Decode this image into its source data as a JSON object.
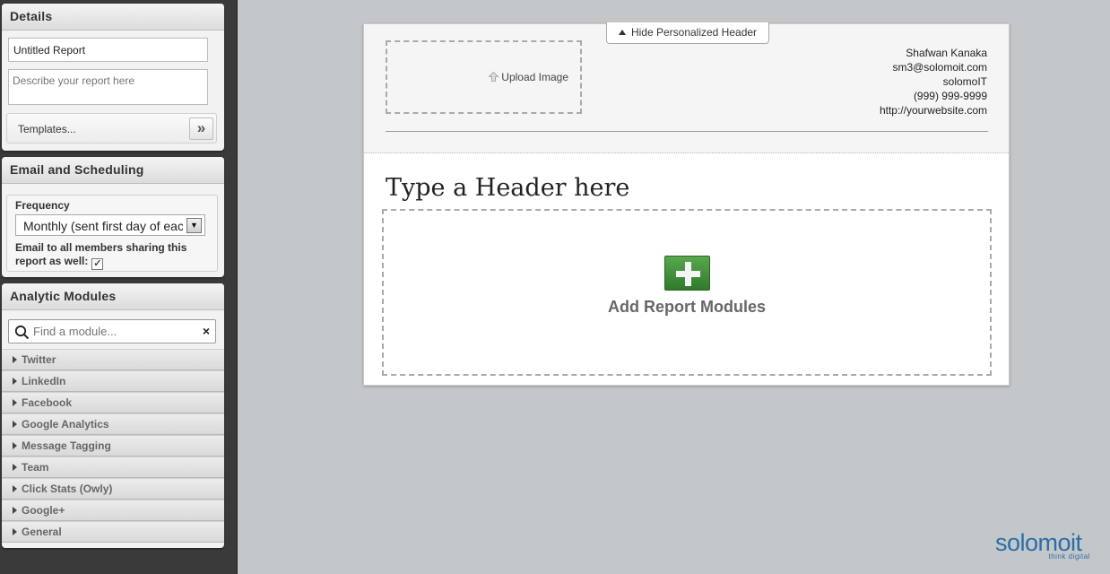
{
  "sidebar": {
    "details": {
      "heading": "Details",
      "title_value": "Untitled Report",
      "description_placeholder": "Describe your report here",
      "templates_label": "Templates...",
      "templates_button": "»"
    },
    "email": {
      "heading": "Email and Scheduling",
      "frequency_label": "Frequency",
      "frequency_value": "Monthly (sent first day of each month)",
      "share_label": "Email to all members sharing this report as well:",
      "share_checked": true
    },
    "modules": {
      "heading": "Analytic Modules",
      "search_placeholder": "Find a module...",
      "clear_symbol": "×",
      "items": [
        {
          "label": "Twitter"
        },
        {
          "label": "LinkedIn"
        },
        {
          "label": "Facebook"
        },
        {
          "label": "Google Analytics"
        },
        {
          "label": "Message Tagging"
        },
        {
          "label": "Team"
        },
        {
          "label": "Click Stats (Owly)"
        },
        {
          "label": "Google+"
        },
        {
          "label": "General"
        }
      ]
    }
  },
  "report": {
    "hide_header_label": "Hide Personalized Header",
    "upload_label": "Upload Image",
    "contact": {
      "name": "Shafwan Kanaka",
      "email": "sm3@solomoit.com",
      "company": "solomoIT",
      "phone": "(999) 999-9999",
      "website": "http://yourwebsite.com"
    },
    "header_placeholder": "Type a Header here",
    "add_modules_label": "Add Report Modules"
  },
  "logo": {
    "text": "solomoit",
    "tagline": "think digital"
  },
  "colors": {
    "sidebar_bg": "#3a3a3a",
    "canvas_bg": "#c4c7ca",
    "add_button": "#3f8f3a",
    "logo": "#2a6ea6"
  }
}
